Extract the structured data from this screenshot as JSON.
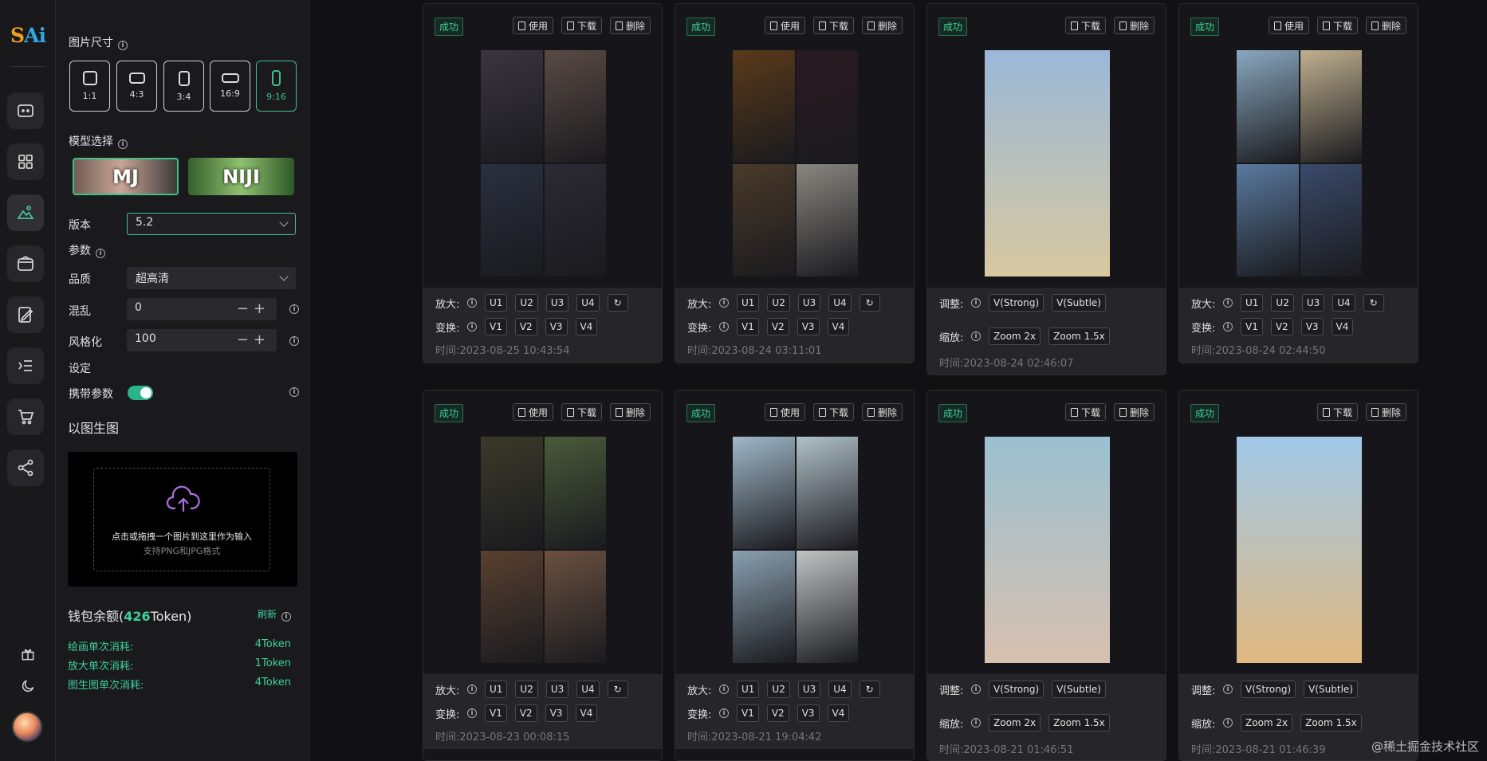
{
  "logo": {
    "a": "S",
    "b": "Ai"
  },
  "rail": {
    "items": [
      "chat-icon",
      "grid-icon",
      "image-gen-icon",
      "wallet-icon",
      "edit-icon",
      "list-icon",
      "cart-icon",
      "share-icon"
    ],
    "bottom": [
      "gift-icon",
      "moon-icon"
    ]
  },
  "panel": {
    "size_label": "图片尺寸",
    "sizes": [
      "1:1",
      "4:3",
      "3:4",
      "16:9",
      "9:16"
    ],
    "selected_size": "9:16",
    "model_label": "模型选择",
    "models": [
      "MJ",
      "NIJI"
    ],
    "selected_model": "MJ",
    "version_label": "版本",
    "version_value": "5.2",
    "params_label": "参数",
    "quality_label": "品质",
    "quality_value": "超高清",
    "chaos_label": "混乱",
    "chaos_value": "0",
    "stylize_label": "风格化",
    "stylize_value": "100",
    "settings_label": "设定",
    "carry_label": "携带参数",
    "carry_on": true,
    "img2img_label": "以图生图",
    "upload_text": "点击或拖拽一个图片到这里作为输入",
    "upload_hint": "支持PNG和JPG格式",
    "wallet_prefix": "钱包余额(",
    "wallet_amount": "426",
    "wallet_suffix": "Token)",
    "refresh": "刷新",
    "costs": [
      {
        "label": "绘画单次消耗:",
        "value": "4Token"
      },
      {
        "label": "放大单次消耗:",
        "value": "1Token"
      },
      {
        "label": "图生图单次消耗:",
        "value": "4Token"
      }
    ]
  },
  "labels": {
    "success": "成功",
    "use": "使用",
    "download": "下载",
    "delete": "删除",
    "upscale": "放大:",
    "variation": "变换:",
    "adjust": "调整:",
    "zoom": "缩放:",
    "time_prefix": "时间:"
  },
  "u_buttons": [
    "U1",
    "U2",
    "U3",
    "U4"
  ],
  "v_buttons": [
    "V1",
    "V2",
    "V3",
    "V4"
  ],
  "adjust_buttons": [
    "V(Strong)",
    "V(Subtle)"
  ],
  "zoom_buttons": [
    "Zoom 2x",
    "Zoom 1.5x"
  ],
  "cards": [
    {
      "type": "grid",
      "time": "2023-08-25 10:43:54",
      "colors": [
        "#3a3540",
        "#5a4a44",
        "#2a3040",
        "#2c2a34"
      ]
    },
    {
      "type": "grid",
      "time": "2023-08-24 03:11:01",
      "colors": [
        "#5a3a1a",
        "#2a1a22",
        "#4a3a2a",
        "#8a8680"
      ]
    },
    {
      "type": "single",
      "time": "2023-08-24 02:46:07",
      "colors": [
        "#9ab8d8",
        "#d8c8a0"
      ]
    },
    {
      "type": "grid",
      "time": "2023-08-24 02:44:50",
      "colors": [
        "#8aa8c0",
        "#c0b090",
        "#5a7aa0",
        "#3a4a6a"
      ]
    },
    {
      "type": "grid",
      "time": "2023-08-23 00:08:15",
      "colors": [
        "#3a3a2a",
        "#4a5a3a",
        "#5a4030",
        "#6a5040"
      ]
    },
    {
      "type": "grid",
      "time": "2023-08-21 19:04:42",
      "colors": [
        "#a0b8c8",
        "#b0c0c8",
        "#8aa0b0",
        "#c0c4c4"
      ]
    },
    {
      "type": "single",
      "time": "2023-08-21 01:46:51",
      "colors": [
        "#9ac0d0",
        "#d8c0b0"
      ]
    },
    {
      "type": "single",
      "time": "2023-08-21 01:46:39",
      "colors": [
        "#a0c8e8",
        "#e0b880"
      ]
    }
  ],
  "watermark": "@稀土掘金技术社区"
}
